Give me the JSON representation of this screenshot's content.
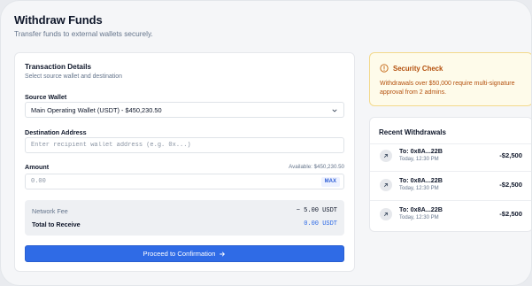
{
  "header": {
    "title": "Withdraw Funds",
    "subtitle": "Transfer funds to external wallets securely."
  },
  "transaction": {
    "title": "Transaction Details",
    "subtitle": "Select source wallet and destination",
    "source_label": "Source Wallet",
    "source_value": "Main Operating Wallet (USDT) - $450,230.50",
    "destination_label": "Destination Address",
    "destination_placeholder": "Enter recipient wallet address (e.g. 0x...)",
    "destination_value": "",
    "amount_label": "Amount",
    "available": "Available: $450,230.50",
    "amount_value": "0.00",
    "max_label": "MAX",
    "fee_label": "Network Fee",
    "fee_value": "~ 5.00 USDT",
    "total_label": "Total to Receive",
    "total_value": "0.00 USDT",
    "proceed_label": "Proceed to Confirmation"
  },
  "security": {
    "title": "Security Check",
    "text": "Withdrawals over $50,000 require multi-signature approval from 2 admins."
  },
  "recent": {
    "title": "Recent Withdrawals",
    "items": [
      {
        "to": "To: 0x8A...22B",
        "time": "Today, 12:30 PM",
        "amount": "-$2,500"
      },
      {
        "to": "To: 0x8A...22B",
        "time": "Today, 12:30 PM",
        "amount": "-$2,500"
      },
      {
        "to": "To: 0x8A...22B",
        "time": "Today, 12:30 PM",
        "amount": "-$2,500"
      }
    ]
  },
  "colors": {
    "accent": "#2f6be6",
    "warning_text": "#b4500d",
    "warning_bg": "#fefbea"
  },
  "icons": {
    "dropdown": "chevron-down-icon",
    "proceed": "arrow-right-icon",
    "security": "alert-circle-icon",
    "withdrawal": "arrow-up-right-icon"
  }
}
